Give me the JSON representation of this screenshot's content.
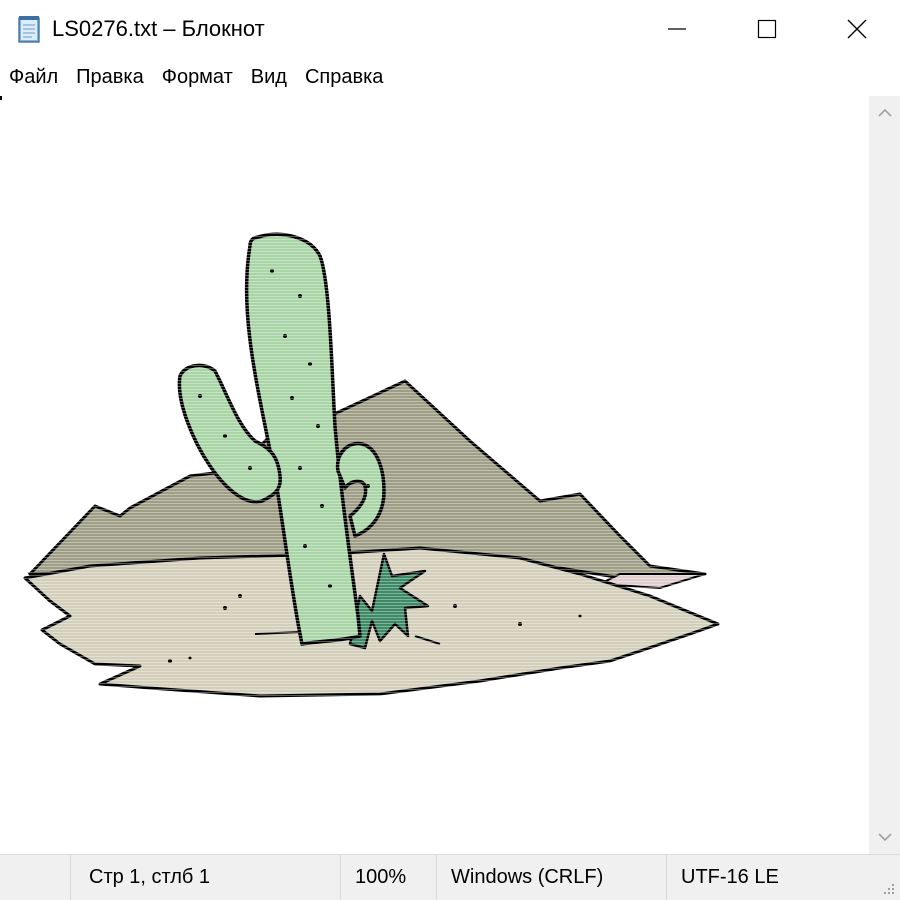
{
  "window": {
    "title": "LS0276.txt – Блокнот",
    "icon": "notepad-icon",
    "controls": {
      "minimize_icon": "minimize-icon",
      "maximize_icon": "maximize-icon",
      "close_icon": "close-icon"
    }
  },
  "menu": {
    "items": [
      {
        "label": "Файл"
      },
      {
        "label": "Правка"
      },
      {
        "label": "Формат"
      },
      {
        "label": "Вид"
      },
      {
        "label": "Справка"
      }
    ]
  },
  "editor": {
    "content_description_icon": "ascii-art-cactus-image",
    "colors": {
      "cactus": "#a8d4a6",
      "mountain": "#9e9d86",
      "sand": "#d3cfbb",
      "agave": "#3f8a66",
      "outline": "#000000"
    }
  },
  "scrollbar": {
    "up_icon": "chevron-up-icon",
    "down_icon": "chevron-down-icon"
  },
  "status": {
    "position": "Стр 1, стлб 1",
    "zoom": "100%",
    "line_ending": "Windows (CRLF)",
    "encoding": "UTF-16 LE"
  }
}
